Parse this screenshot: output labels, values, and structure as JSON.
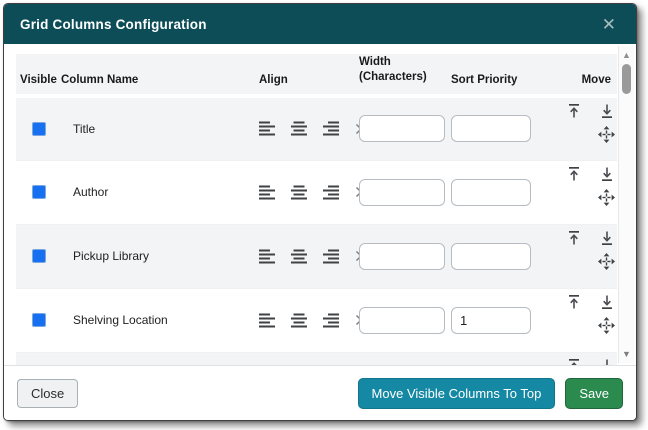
{
  "dialog": {
    "title": "Grid Columns Configuration",
    "close_icon": "✕"
  },
  "table": {
    "headers": {
      "visible": "Visible",
      "column_name": "Column Name",
      "align": "Align",
      "width_line1": "Width",
      "width_line2": "(Characters)",
      "sort_priority": "Sort Priority",
      "move": "Move"
    },
    "rows": [
      {
        "name": "Title",
        "visible": true,
        "width": "",
        "sort_priority": ""
      },
      {
        "name": "Author",
        "visible": true,
        "width": "",
        "sort_priority": ""
      },
      {
        "name": "Pickup Library",
        "visible": true,
        "width": "",
        "sort_priority": ""
      },
      {
        "name": "Shelving Location",
        "visible": true,
        "width": "",
        "sort_priority": "1"
      },
      {
        "name": "",
        "width": "",
        "sort_priority": "",
        "partial": true
      }
    ]
  },
  "scrollbar": {
    "up_icon": "▲",
    "down_icon": "▼"
  },
  "footer": {
    "close_label": "Close",
    "move_visible_label": "Move Visible Columns To Top",
    "save_label": "Save"
  },
  "icons": {
    "close": "x-close",
    "align_left": "align-left-lines",
    "align_center": "align-center-lines",
    "align_right": "align-right-lines",
    "clear_align": "x-clear",
    "move_to_top": "arrow-to-top-bar",
    "move_to_bottom": "arrow-to-bottom-bar",
    "drag": "four-way-arrows",
    "scroll_up": "triangle-up",
    "scroll_down": "triangle-down"
  },
  "colors": {
    "header_bg": "#0d4d57",
    "accent_teal": "#1588a3",
    "save_green": "#2b8a4e",
    "checkbox_blue": "#1670f0",
    "row_stripe": "#f3f4f5"
  }
}
